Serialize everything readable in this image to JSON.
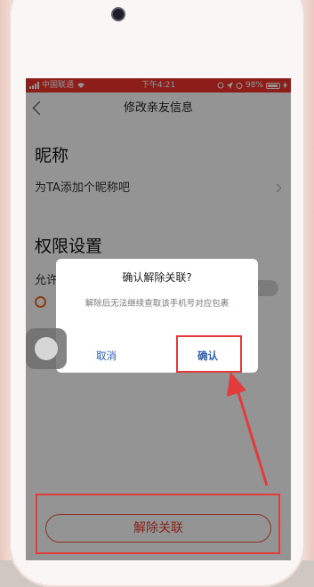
{
  "status_bar": {
    "carrier": "中国联通",
    "time": "下午4:21",
    "battery": "98%"
  },
  "nav": {
    "title": "修改亲友信息"
  },
  "nickname": {
    "section_title": "昵称",
    "placeholder": "为TA添加个昵称吧"
  },
  "permissions": {
    "section_title": "权限设置",
    "allow_label": "允许"
  },
  "unlink_button": {
    "label": "解除关联"
  },
  "dialog": {
    "title": "确认解除关联?",
    "message": "解除后无法继续查取该手机号对应包裹",
    "cancel_label": "取消",
    "confirm_label": "确认"
  },
  "colors": {
    "status_bar": "#f2332a",
    "accent_red": "#e7402f",
    "dialog_button": "#2a5fb3",
    "annotation": "#e23b3b"
  }
}
